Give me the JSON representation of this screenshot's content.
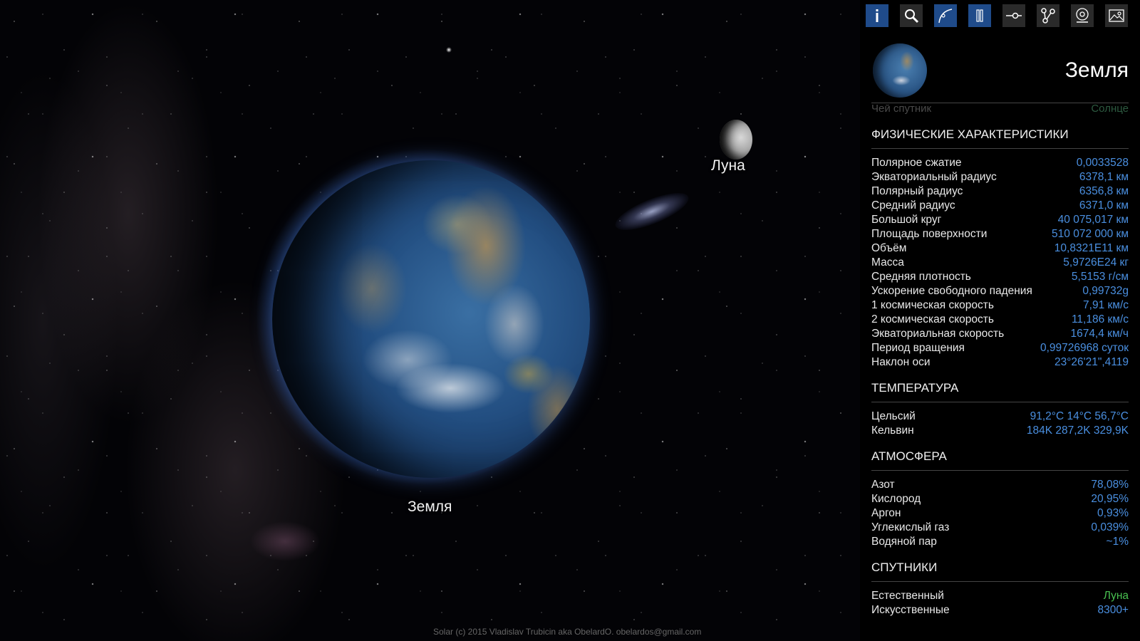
{
  "scene": {
    "earth_label": "Земля",
    "moon_label": "Луна",
    "credits": "Solar (c) 2015 Vladislav Trubicin aka ObelardO. obelardos@gmail.com"
  },
  "toolbar": [
    {
      "name": "info",
      "active": true
    },
    {
      "name": "search",
      "active": false
    },
    {
      "name": "orbits",
      "active": true
    },
    {
      "name": "pause",
      "active": true
    },
    {
      "name": "link",
      "active": false
    },
    {
      "name": "share",
      "active": false
    },
    {
      "name": "contact",
      "active": false
    },
    {
      "name": "image",
      "active": false
    }
  ],
  "panel": {
    "title": "Земля",
    "faded_row": {
      "label": "Чей спутник",
      "value": "Солнце"
    },
    "sections": [
      {
        "title": "ФИЗИЧЕСКИЕ ХАРАКТЕРИСТИКИ",
        "rows": [
          {
            "label": "Полярное сжатие",
            "value": "0,0033528"
          },
          {
            "label": "Экваториальный радиус",
            "value": "6378,1 км"
          },
          {
            "label": "Полярный радиус",
            "value": "6356,8 км"
          },
          {
            "label": "Средний радиус",
            "value": "6371,0 км"
          },
          {
            "label": "Большой круг",
            "value": "40 075,017 км"
          },
          {
            "label": "Площадь поверхности",
            "value": "510 072 000 км"
          },
          {
            "label": "Объём",
            "value": "10,8321E11 км"
          },
          {
            "label": "Масса",
            "value": "5,9726E24 кг"
          },
          {
            "label": "Средняя плотность",
            "value": "5,5153 г/см"
          },
          {
            "label": "Ускорение свободного падения",
            "value": "0,99732g"
          },
          {
            "label": "1 космическая скорость",
            "value": "7,91 км/с"
          },
          {
            "label": "2 космическая скорость",
            "value": "11,186 км/с"
          },
          {
            "label": "Экваториальная скорость",
            "value": "1674,4 км/ч"
          },
          {
            "label": "Период вращения",
            "value": "0,99726968 суток"
          },
          {
            "label": "Наклон оси",
            "value": "23°26'21\",4119"
          }
        ]
      },
      {
        "title": "ТЕМПЕРАТУРА",
        "rows": [
          {
            "label": "Цельсий",
            "value": "91,2°C 14°C 56,7°C"
          },
          {
            "label": "Кельвин",
            "value": "184K 287,2K 329,9K"
          }
        ]
      },
      {
        "title": "АТМОСФЕРА",
        "rows": [
          {
            "label": "Азот",
            "value": "78,08%"
          },
          {
            "label": "Кислород",
            "value": "20,95%"
          },
          {
            "label": "Аргон",
            "value": "0,93%"
          },
          {
            "label": "Углекислый газ",
            "value": "0,039%"
          },
          {
            "label": "Водяной пар",
            "value": "~1%"
          }
        ]
      },
      {
        "title": "СПУТНИКИ",
        "rows": [
          {
            "label": "Естественный",
            "value": "Луна",
            "link": true
          },
          {
            "label": "Искусственные",
            "value": "8300+"
          }
        ]
      }
    ]
  },
  "colors": {
    "accent": "#4a8fe0",
    "link_green": "#48c050",
    "toolbar_active": "#1f4b8a",
    "toolbar_inactive": "#2a2a2a"
  }
}
